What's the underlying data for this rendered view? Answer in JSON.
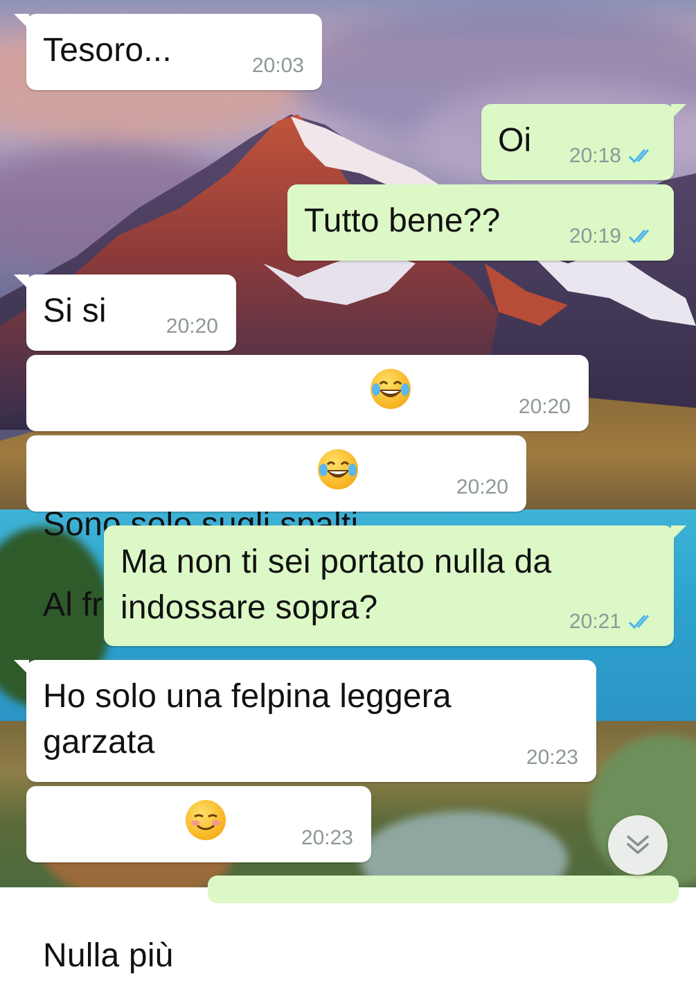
{
  "chat": {
    "messages": [
      {
        "direction": "in",
        "text": "Tesoro...",
        "time": "20:03"
      },
      {
        "direction": "out",
        "text": "Oi",
        "time": "20:18",
        "status": "read"
      },
      {
        "direction": "out",
        "text": "Tutto bene??",
        "time": "20:19",
        "status": "read"
      },
      {
        "direction": "in",
        "text": "Si si",
        "time": "20:20"
      },
      {
        "direction": "in",
        "text": "Sono solo sugli spalti",
        "emoji": "face-with-tears-of-joy",
        "time": "20:20"
      },
      {
        "direction": "in",
        "text": "Al freddo perlopiù",
        "emoji": "face-with-tears-of-joy",
        "time": "20:20"
      },
      {
        "direction": "out",
        "text": "Ma non ti sei portato nulla da indossare sopra?",
        "time": "20:21",
        "status": "read"
      },
      {
        "direction": "in",
        "text": "Ho solo una felpina leggera garzata",
        "time": "20:23"
      },
      {
        "direction": "in",
        "text": "Nulla più",
        "emoji": "smiling-face",
        "time": "20:23"
      }
    ]
  },
  "controls": {
    "scroll_down_icon": "double-chevron-down-icon"
  },
  "colors": {
    "incoming_bubble": "#ffffff",
    "outgoing_bubble": "#dcf8c6",
    "read_ticks": "#4fb6ec",
    "timestamp": "#8d9896"
  }
}
